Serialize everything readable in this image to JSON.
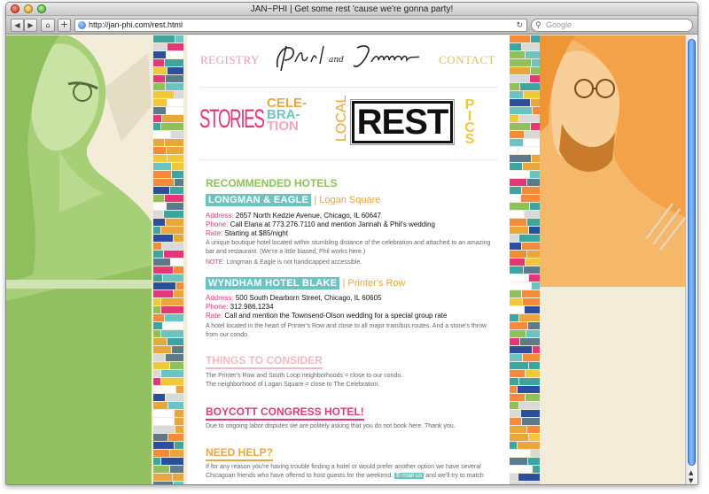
{
  "window": {
    "title": "JAN~PHI | Get some rest 'cause we're gonna party!"
  },
  "toolbar": {
    "url": "http://jan-phi.com/rest.html",
    "search_placeholder": "Google"
  },
  "nav": {
    "registry": "REGISTRY",
    "contact": "CONTACT",
    "logo": "Phil and Jannah",
    "logo_and": "and",
    "stories": "STORIES",
    "celebration": [
      "CELE-",
      "BRA-",
      "TION"
    ],
    "local": "LOCAL",
    "rest": "REST",
    "pics": "PICS"
  },
  "sections": {
    "recommended": "RECOMMENDED HOTELS",
    "things": "THINGS TO CONSIDER",
    "boycott": "BOYCOTT CONGRESS HOTEL!",
    "help": "NEED HELP?"
  },
  "hotels": [
    {
      "name": "LONGMAN & EAGLE",
      "area": "Logan Square",
      "address_label": "Address:",
      "address": "2657 North Kedzie Avenue, Chicago, IL 60647",
      "phone_label": "Phone:",
      "phone": "Call Elana at 773.276.7110 and mention Jannah & Phil's wedding",
      "rate_label": "Rate:",
      "rate": "Starting at $85/night",
      "description": "A unique boutique hotel located within stumbling distance of the celebration and attached to an amazing bar and restaurant. (We're a little biased, Phil works here.)",
      "note_label": "NOTE:",
      "note": "Longman & Eagle is not handicapped accessible."
    },
    {
      "name": "WYNDHAM HOTEL BLAKE",
      "area": "Printer's Row",
      "address_label": "Address:",
      "address": "500 South Dearborn Street, Chicago, IL 60605",
      "phone_label": "Phone:",
      "phone": "312.986.1234",
      "rate_label": "Rate:",
      "rate": "Call and mention the Townsend-Olson wedding for a special group rate",
      "description": "A hotel located in the heart of Printer's Row and close to all major train/bus routes. And a stone's throw from our condo."
    }
  ],
  "things": {
    "line1": "The Printer's Row and South Loop neighborhoods = close to our condo.",
    "line2": "The neighborhood of Logan Square = close to The Celebration."
  },
  "boycott_text": "Due to ongoing labor disputes we are politely asking that you do not book here. Thank you.",
  "help": {
    "text_before": "If for any reason you're having trouble finding a hotel or would prefer another option we have several Chicagoan friends who have offered to host guests for the weekend.",
    "email_link": "E-mail us",
    "text_after": "and we'll try to match"
  },
  "colors": {
    "pink": "#e4377a",
    "teal": "#6bc4c2",
    "orange": "#e9a63b",
    "green": "#8fc05a",
    "rest_black": "#111111"
  }
}
